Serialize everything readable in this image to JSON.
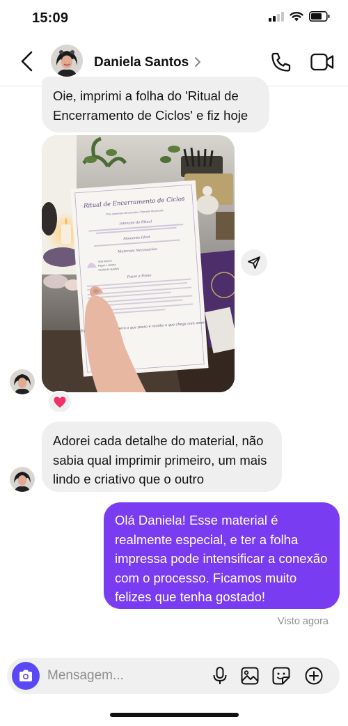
{
  "status_bar": {
    "time": "15:09"
  },
  "header": {
    "contact_name": "Daniela Santos"
  },
  "messages": [
    {
      "from": "contact",
      "text": "Oie, imprimi a folha do 'Ritual de Encerramento de Ciclos' e fiz hoje"
    },
    {
      "from": "contact",
      "type": "photo",
      "photo_text": {
        "title": "Ritual de Encerramento de Ciclos",
        "subtitle": "Para momentos de transição e liberação do passado",
        "sec1": "Intenção do Ritual",
        "sec2": "Momento Ideal",
        "sec3": "Materiais Necessários",
        "items": [
          "Vela branca",
          "Papel e caneta",
          "Cristal de quartzo"
        ],
        "sec4": "Passo a Passo",
        "closing": "Eu honro o que foi, libero o que passa e recebo o que chega com amor"
      },
      "reaction": "heart"
    },
    {
      "from": "contact",
      "text": "Adorei cada detalhe do material, não sabia qual imprimir primeiro, um mais lindo e criativo que o outro"
    },
    {
      "from": "me",
      "text": "Olá Daniela! Esse material é realmente especial, e ter a folha impressa pode intensificar a conexão com o processo. Ficamos muito felizes que tenha gostado!"
    }
  ],
  "seen_status": "Visto agora",
  "composer": {
    "placeholder": "Mensagem..."
  },
  "colors": {
    "outgoing_bubble": "#7a3cf0",
    "incoming_bubble": "#efefef",
    "camera_button": "#5a48f5",
    "reaction_heart": "#f0306a"
  }
}
